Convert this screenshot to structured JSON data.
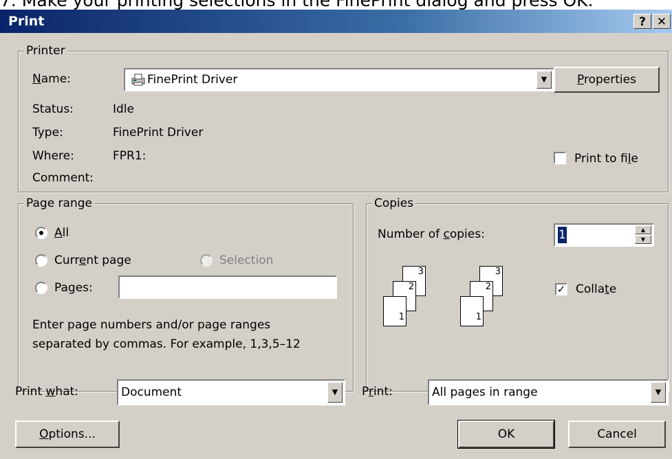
{
  "instruction": "7.   Make your printing selections in the FinePrint dialog and press OK.",
  "window": {
    "title": "Print",
    "help_glyph": "?",
    "close_glyph": "✕"
  },
  "printer": {
    "group_label": "Printer",
    "name_label_u": "N",
    "name_label_rest": "ame:",
    "name_value": "FinePrint Driver",
    "printer_icon": "printer-icon",
    "properties_label_u": "P",
    "properties_label_rest": "roperties",
    "status_label": "Status:",
    "status_value": "Idle",
    "type_label": "Type:",
    "type_value": "FinePrint Driver",
    "where_label": "Where:",
    "where_value": "FPR1:",
    "comment_label": "Comment:",
    "print_to_file_pre": "Print to fi",
    "print_to_file_u": "l",
    "print_to_file_post": "e",
    "print_to_file_checked": false
  },
  "page_range": {
    "group_label": "Page range",
    "all_u": "A",
    "all_rest": "ll",
    "current_pre": "Curr",
    "current_u": "e",
    "current_post": "nt page",
    "selection_label": "Selection",
    "pages_pre": "Pa",
    "pages_u": "g",
    "pages_post": "es:",
    "pages_value": "",
    "hint_line1": "Enter page numbers and/or page ranges",
    "hint_line2": "separated by commas.  For example, 1,3,5–12",
    "selected": "all"
  },
  "copies": {
    "group_label": "Copies",
    "number_pre": "Number of ",
    "number_u": "c",
    "number_post": "opies:",
    "number_value": "1",
    "collate_pre": "Colla",
    "collate_u": "t",
    "collate_post": "e",
    "collate_checked": true,
    "page_numbers": [
      "1",
      "2",
      "3"
    ]
  },
  "bottom": {
    "print_what_pre": "Print ",
    "print_what_u": "w",
    "print_what_post": "hat:",
    "print_what_value": "Document",
    "print_pre": "P",
    "print_u": "r",
    "print_post": "int:",
    "print_value": "All pages in range",
    "options_u": "O",
    "options_rest": "ptions...",
    "ok_label": "OK",
    "cancel_label": "Cancel"
  },
  "colors": {
    "face": "#d4d0c8",
    "title_start": "#0a246a",
    "title_end": "#a6caf0"
  }
}
